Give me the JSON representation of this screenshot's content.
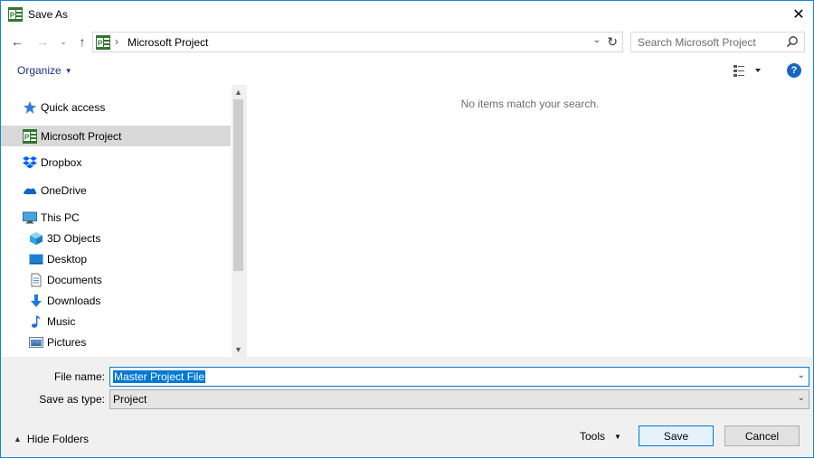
{
  "window": {
    "title": "Save As",
    "title_icon": "microsoft-project-icon",
    "close_glyph": "✕"
  },
  "nav": {
    "back_glyph": "←",
    "forward_glyph": "→",
    "recent_glyph": "⌄",
    "up_glyph": "↑"
  },
  "address": {
    "separator": "›",
    "crumb": "Microsoft Project",
    "dropdown_glyph": "⌄",
    "refresh_glyph": "↻"
  },
  "search": {
    "placeholder": "Search Microsoft Project"
  },
  "toolbar": {
    "organize_label": "Organize",
    "caret": "▼",
    "help_glyph": "?"
  },
  "sidebar": {
    "items": [
      {
        "label": "Quick access",
        "icon": "star-icon"
      },
      {
        "label": "Microsoft Project",
        "icon": "microsoft-project-icon",
        "selected": true
      },
      {
        "label": "Dropbox",
        "icon": "dropbox-icon"
      },
      {
        "label": "OneDrive",
        "icon": "cloud-icon"
      },
      {
        "label": "This PC",
        "icon": "computer-icon"
      },
      {
        "label": "3D Objects",
        "icon": "cube-icon"
      },
      {
        "label": "Desktop",
        "icon": "desktop-icon"
      },
      {
        "label": "Documents",
        "icon": "document-icon"
      },
      {
        "label": "Downloads",
        "icon": "download-arrow-icon"
      },
      {
        "label": "Music",
        "icon": "music-note-icon"
      },
      {
        "label": "Pictures",
        "icon": "picture-icon"
      }
    ]
  },
  "scrollbar": {
    "up_glyph": "▲",
    "down_glyph": "▼"
  },
  "content": {
    "empty_message": "No items match your search."
  },
  "form": {
    "file_name_label": "File name:",
    "file_name_value": "Master Project File",
    "save_type_label": "Save as type:",
    "save_type_value": "Project",
    "dropdown_glyph": "⌄"
  },
  "footer": {
    "hide_folders_glyph": "▲",
    "hide_folders_label": "Hide Folders",
    "tools_label": "Tools",
    "tools_caret": "▼",
    "save_label": "Save",
    "cancel_label": "Cancel"
  },
  "colors": {
    "accent": "#0078d7",
    "project_green": "#31752f",
    "selected_bg": "#d9d9d9",
    "panel_bg": "#f0f0f0"
  }
}
